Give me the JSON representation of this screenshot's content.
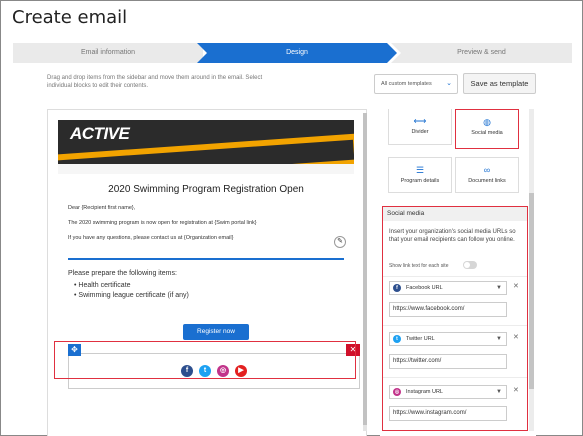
{
  "page": {
    "title": "Create email"
  },
  "steps": [
    {
      "label": "Email information",
      "active": false
    },
    {
      "label": "Design",
      "active": true
    },
    {
      "label": "Preview & send",
      "active": false
    }
  ],
  "instructions": "Drag and drop items from the sidebar and move them around in the email. Select individual blocks to edit their contents.",
  "toolbar": {
    "template_select": "All custom templates",
    "save_template_label": "Save as template"
  },
  "email": {
    "logo_text": "ACTIVE",
    "heading": "2020 Swimming Program Registration Open",
    "greeting": "Dear {Recipient first name},",
    "para1": "The 2020 swimming program is now open for registration at {Swim portal link}",
    "para2": "If you have any questions, please contact us at {Organization email}",
    "prepare_text": "Please prepare the following items:",
    "prepare_items": [
      "Health certificate",
      "Swimming league certificate (if any)"
    ],
    "register_label": "Register now",
    "move_icon": "arrows-move-icon",
    "close_icon": "close-icon",
    "social_icons": [
      {
        "name": "facebook-icon",
        "glyph": "f",
        "color": "#2d4f8e"
      },
      {
        "name": "twitter-icon",
        "glyph": "t",
        "color": "#1da1f2"
      },
      {
        "name": "instagram-icon",
        "glyph": "◎",
        "color": "#c2338a"
      },
      {
        "name": "youtube-icon",
        "glyph": "▶",
        "color": "#e32020"
      }
    ]
  },
  "sidebar": {
    "tiles": [
      {
        "label": "Divider",
        "icon": "divider-icon",
        "glyph": "⟷"
      },
      {
        "label": "Social media",
        "icon": "globe-icon",
        "glyph": "◍"
      },
      {
        "label": "Program details",
        "icon": "list-icon",
        "glyph": "☰"
      },
      {
        "label": "Document links",
        "icon": "link-icon",
        "glyph": "∞"
      }
    ],
    "social_panel": {
      "title": "Social media",
      "description": "Insert your organization's social media URLs so that your email recipients can follow you online.",
      "toggle_label": "Show link text for each site",
      "toggle_on": false,
      "networks": [
        {
          "name": "Facebook URL",
          "icon": "facebook-icon",
          "glyph": "f",
          "color": "#2d4f8e",
          "value": "https://www.facebook.com/"
        },
        {
          "name": "Twitter URL",
          "icon": "twitter-icon",
          "glyph": "t",
          "color": "#1da1f2",
          "value": "https://twitter.com/"
        },
        {
          "name": "Instagram URL",
          "icon": "instagram-icon",
          "glyph": "◎",
          "color": "#c2338a",
          "value": "https://www.instagram.com/"
        }
      ]
    }
  }
}
